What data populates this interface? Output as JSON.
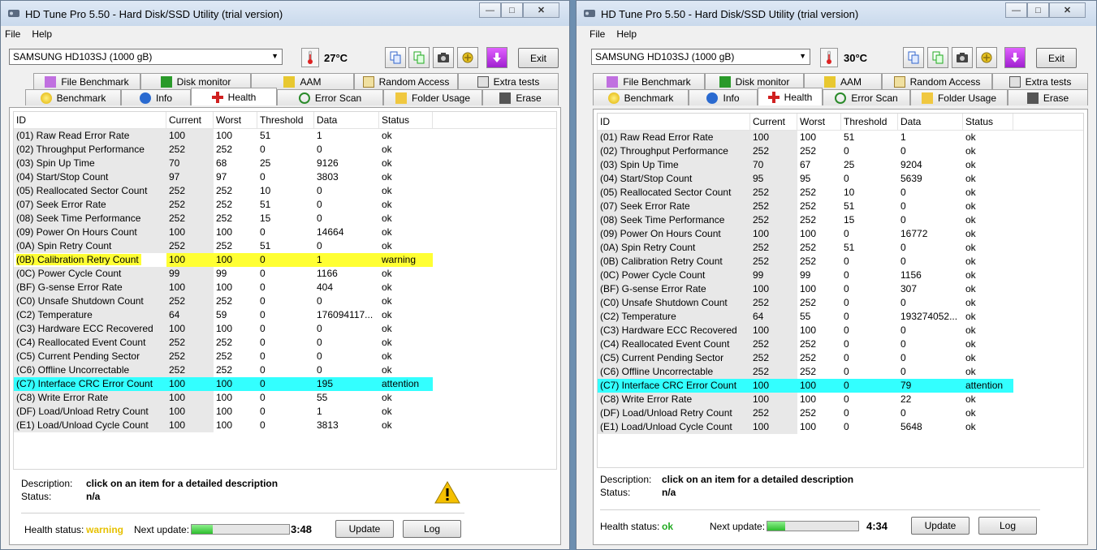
{
  "windows": [
    {
      "title": "HD Tune Pro 5.50 - Hard Disk/SSD Utility (trial version)",
      "menu": [
        "File",
        "Help"
      ],
      "drive": "SAMSUNG HD103SJ (1000 gB)",
      "temperature": "27°C",
      "exit_label": "Exit",
      "tabs_top": [
        "File Benchmark",
        "Disk monitor",
        "AAM",
        "Random Access",
        "Extra tests"
      ],
      "tabs_bottom": [
        "Benchmark",
        "Info",
        "Health",
        "Error Scan",
        "Folder Usage",
        "Erase"
      ],
      "active_tab": "Health",
      "columns": [
        "ID",
        "Current",
        "Worst",
        "Threshold",
        "Data",
        "Status"
      ],
      "rows": [
        [
          "(01) Raw Read Error Rate",
          "100",
          "100",
          "51",
          "1",
          "ok"
        ],
        [
          "(02) Throughput Performance",
          "252",
          "252",
          "0",
          "0",
          "ok"
        ],
        [
          "(03) Spin Up Time",
          "70",
          "68",
          "25",
          "9126",
          "ok"
        ],
        [
          "(04) Start/Stop Count",
          "97",
          "97",
          "0",
          "3803",
          "ok"
        ],
        [
          "(05) Reallocated Sector Count",
          "252",
          "252",
          "10",
          "0",
          "ok"
        ],
        [
          "(07) Seek Error Rate",
          "252",
          "252",
          "51",
          "0",
          "ok"
        ],
        [
          "(08) Seek Time Performance",
          "252",
          "252",
          "15",
          "0",
          "ok"
        ],
        [
          "(09) Power On Hours Count",
          "100",
          "100",
          "0",
          "14664",
          "ok"
        ],
        [
          "(0A) Spin Retry Count",
          "252",
          "252",
          "51",
          "0",
          "ok"
        ],
        [
          "(0B) Calibration Retry Count",
          "100",
          "100",
          "0",
          "1",
          "warning"
        ],
        [
          "(0C) Power Cycle Count",
          "99",
          "99",
          "0",
          "1166",
          "ok"
        ],
        [
          "(BF) G-sense Error Rate",
          "100",
          "100",
          "0",
          "404",
          "ok"
        ],
        [
          "(C0) Unsafe Shutdown Count",
          "252",
          "252",
          "0",
          "0",
          "ok"
        ],
        [
          "(C2) Temperature",
          "64",
          "59",
          "0",
          "176094117...",
          "ok"
        ],
        [
          "(C3) Hardware ECC Recovered",
          "100",
          "100",
          "0",
          "0",
          "ok"
        ],
        [
          "(C4) Reallocated Event Count",
          "252",
          "252",
          "0",
          "0",
          "ok"
        ],
        [
          "(C5) Current Pending Sector",
          "252",
          "252",
          "0",
          "0",
          "ok"
        ],
        [
          "(C6) Offline Uncorrectable",
          "252",
          "252",
          "0",
          "0",
          "ok"
        ],
        [
          "(C7) Interface CRC Error Count",
          "100",
          "100",
          "0",
          "195",
          "attention"
        ],
        [
          "(C8) Write Error Rate",
          "100",
          "100",
          "0",
          "55",
          "ok"
        ],
        [
          "(DF) Load/Unload Retry Count",
          "100",
          "100",
          "0",
          "1",
          "ok"
        ],
        [
          "(E1) Load/Unload Cycle Count",
          "100",
          "100",
          "0",
          "3813",
          "ok"
        ]
      ],
      "description_label": "Description:",
      "description_value": "click on an item for a detailed description",
      "status_label": "Status:",
      "status_value": "n/a",
      "health_label": "Health status:",
      "health_value": "warning",
      "health_color": "#e6c000",
      "next_update_label": "Next update:",
      "progress_fraction": 0.22,
      "countdown": "3:48",
      "update_label": "Update",
      "log_label": "Log",
      "warning_icon": "warning-triangle-icon"
    },
    {
      "title": "HD Tune Pro 5.50 - Hard Disk/SSD Utility (trial version)",
      "menu": [
        "File",
        "Help"
      ],
      "drive": "SAMSUNG HD103SJ (1000 gB)",
      "temperature": "30°C",
      "exit_label": "Exit",
      "tabs_top": [
        "File Benchmark",
        "Disk monitor",
        "AAM",
        "Random Access",
        "Extra tests"
      ],
      "tabs_bottom": [
        "Benchmark",
        "Info",
        "Health",
        "Error Scan",
        "Folder Usage",
        "Erase"
      ],
      "active_tab": "Health",
      "columns": [
        "ID",
        "Current",
        "Worst",
        "Threshold",
        "Data",
        "Status"
      ],
      "rows": [
        [
          "(01) Raw Read Error Rate",
          "100",
          "100",
          "51",
          "1",
          "ok"
        ],
        [
          "(02) Throughput Performance",
          "252",
          "252",
          "0",
          "0",
          "ok"
        ],
        [
          "(03) Spin Up Time",
          "70",
          "67",
          "25",
          "9204",
          "ok"
        ],
        [
          "(04) Start/Stop Count",
          "95",
          "95",
          "0",
          "5639",
          "ok"
        ],
        [
          "(05) Reallocated Sector Count",
          "252",
          "252",
          "10",
          "0",
          "ok"
        ],
        [
          "(07) Seek Error Rate",
          "252",
          "252",
          "51",
          "0",
          "ok"
        ],
        [
          "(08) Seek Time Performance",
          "252",
          "252",
          "15",
          "0",
          "ok"
        ],
        [
          "(09) Power On Hours Count",
          "100",
          "100",
          "0",
          "16772",
          "ok"
        ],
        [
          "(0A) Spin Retry Count",
          "252",
          "252",
          "51",
          "0",
          "ok"
        ],
        [
          "(0B) Calibration Retry Count",
          "252",
          "252",
          "0",
          "0",
          "ok"
        ],
        [
          "(0C) Power Cycle Count",
          "99",
          "99",
          "0",
          "1156",
          "ok"
        ],
        [
          "(BF) G-sense Error Rate",
          "100",
          "100",
          "0",
          "307",
          "ok"
        ],
        [
          "(C0) Unsafe Shutdown Count",
          "252",
          "252",
          "0",
          "0",
          "ok"
        ],
        [
          "(C2) Temperature",
          "64",
          "55",
          "0",
          "193274052...",
          "ok"
        ],
        [
          "(C3) Hardware ECC Recovered",
          "100",
          "100",
          "0",
          "0",
          "ok"
        ],
        [
          "(C4) Reallocated Event Count",
          "252",
          "252",
          "0",
          "0",
          "ok"
        ],
        [
          "(C5) Current Pending Sector",
          "252",
          "252",
          "0",
          "0",
          "ok"
        ],
        [
          "(C6) Offline Uncorrectable",
          "252",
          "252",
          "0",
          "0",
          "ok"
        ],
        [
          "(C7) Interface CRC Error Count",
          "100",
          "100",
          "0",
          "79",
          "attention"
        ],
        [
          "(C8) Write Error Rate",
          "100",
          "100",
          "0",
          "22",
          "ok"
        ],
        [
          "(DF) Load/Unload Retry Count",
          "252",
          "252",
          "0",
          "0",
          "ok"
        ],
        [
          "(E1) Load/Unload Cycle Count",
          "100",
          "100",
          "0",
          "5648",
          "ok"
        ]
      ],
      "description_label": "Description:",
      "description_value": "click on an item for a detailed description",
      "status_label": "Status:",
      "status_value": "n/a",
      "health_label": "Health status:",
      "health_value": "ok",
      "health_color": "#22aa22",
      "next_update_label": "Next update:",
      "progress_fraction": 0.2,
      "countdown": "4:34",
      "update_label": "Update",
      "log_label": "Log"
    }
  ],
  "colors": {
    "warning_row": "#ffff33",
    "attention_row": "#33ffff"
  }
}
